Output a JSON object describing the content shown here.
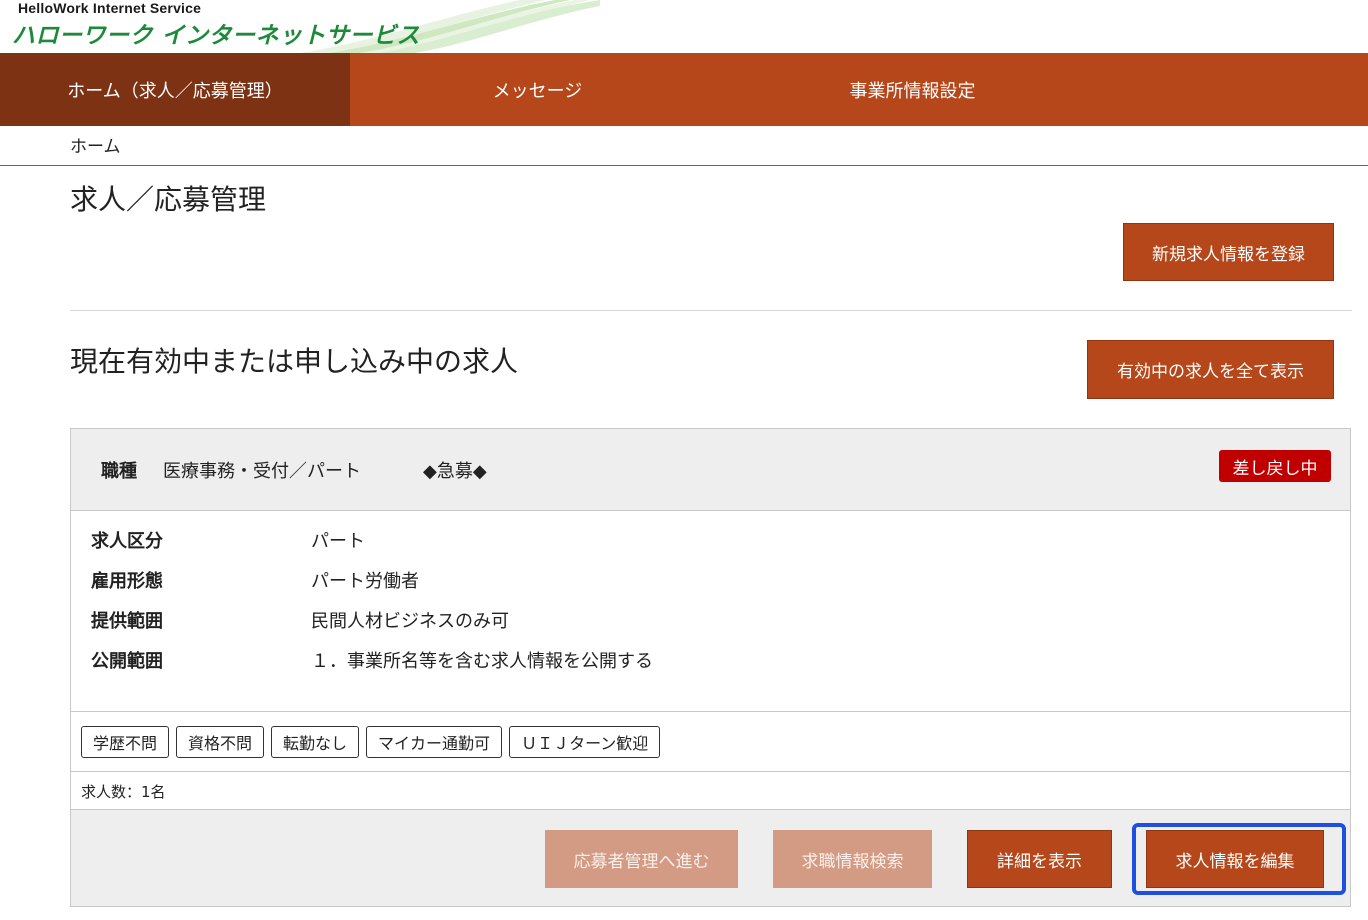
{
  "header": {
    "logo_en": "HelloWork Internet Service",
    "logo_jp": "ハローワーク インターネットサービス"
  },
  "nav": {
    "items": [
      {
        "label": "ホーム（求人／応募管理）",
        "active": true
      },
      {
        "label": "メッセージ",
        "active": false
      },
      {
        "label": "事業所情報設定",
        "active": false
      }
    ]
  },
  "breadcrumb": "ホーム",
  "page": {
    "title": "求人／応募管理",
    "new_job_button": "新規求人情報を登録",
    "section_title": "現在有効中または申し込み中の求人",
    "show_all_button": "有効中の求人を全て表示"
  },
  "job": {
    "occupation_label": "職種",
    "occupation_value": "医療事務・受付／パート",
    "urgent_label": "◆急募◆",
    "status_badge": "差し戻し中",
    "info": [
      {
        "label": "求人区分",
        "value": "パート"
      },
      {
        "label": "雇用形態",
        "value": "パート労働者"
      },
      {
        "label": "提供範囲",
        "value": "民間人材ビジネスのみ可"
      },
      {
        "label": "公開範囲",
        "value": "１．事業所名等を含む求人情報を公開する"
      }
    ],
    "tags": [
      "学歴不問",
      "資格不問",
      "転勤なし",
      "マイカー通勤可",
      "ＵＩＪターン歓迎"
    ],
    "count_text": "求人数：1名",
    "buttons": {
      "applicant": "応募者管理へ進む",
      "search": "求職情報検索",
      "detail": "詳細を表示",
      "edit": "求人情報を編集"
    }
  },
  "colors": {
    "brand": "#b5471a",
    "brand_dark": "#7e3214",
    "badge_red": "#c00000",
    "logo_green": "#1d8a3a",
    "highlight_blue": "#1f4fe0"
  }
}
